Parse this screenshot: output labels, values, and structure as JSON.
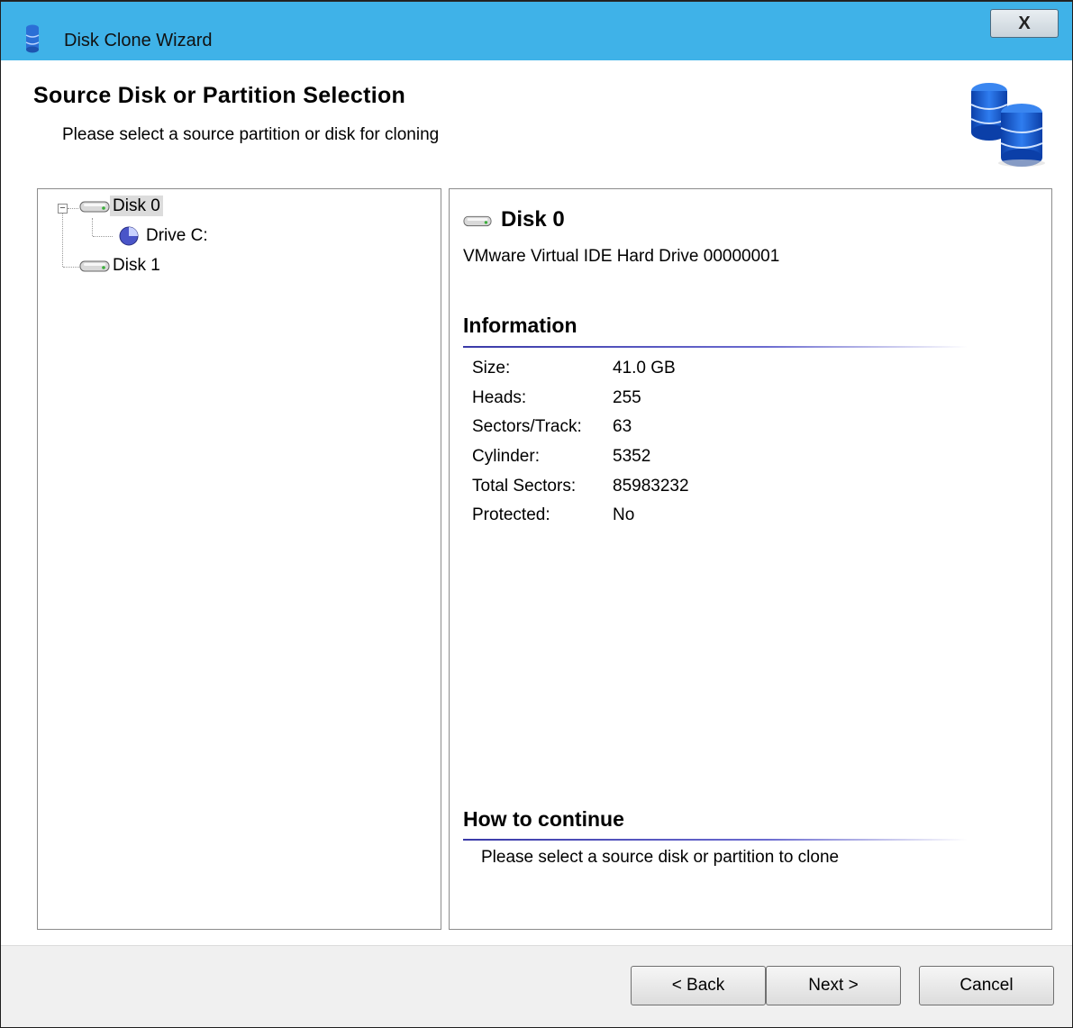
{
  "window": {
    "title": "Disk Clone Wizard",
    "close_label": "X"
  },
  "header": {
    "title": "Source Disk or Partition Selection",
    "subtitle": "Please select a source partition or disk for cloning"
  },
  "tree": {
    "items": [
      {
        "label": "Disk 0",
        "icon": "hard-disk-icon",
        "selected": true,
        "expanded": true
      },
      {
        "label": "Drive C:",
        "icon": "partition-icon",
        "selected": false
      },
      {
        "label": "Disk 1",
        "icon": "hard-disk-icon",
        "selected": false
      }
    ]
  },
  "detail": {
    "title": "Disk 0",
    "description": "VMware Virtual IDE Hard Drive 00000001",
    "info_heading": "Information",
    "info": [
      {
        "key": "Size:",
        "value": "41.0 GB"
      },
      {
        "key": "Heads:",
        "value": "255"
      },
      {
        "key": "Sectors/Track:",
        "value": "63"
      },
      {
        "key": "Cylinder:",
        "value": "5352"
      },
      {
        "key": "Total Sectors:",
        "value": "85983232"
      },
      {
        "key": "Protected:",
        "value": "No"
      }
    ],
    "how_heading": "How to continue",
    "how_text": "Please select a source disk or partition to clone"
  },
  "buttons": {
    "back": "< Back",
    "next": "Next >",
    "cancel": "Cancel"
  },
  "colors": {
    "titlebar": "#3fb2e8",
    "rule": "#3a3aa8"
  }
}
